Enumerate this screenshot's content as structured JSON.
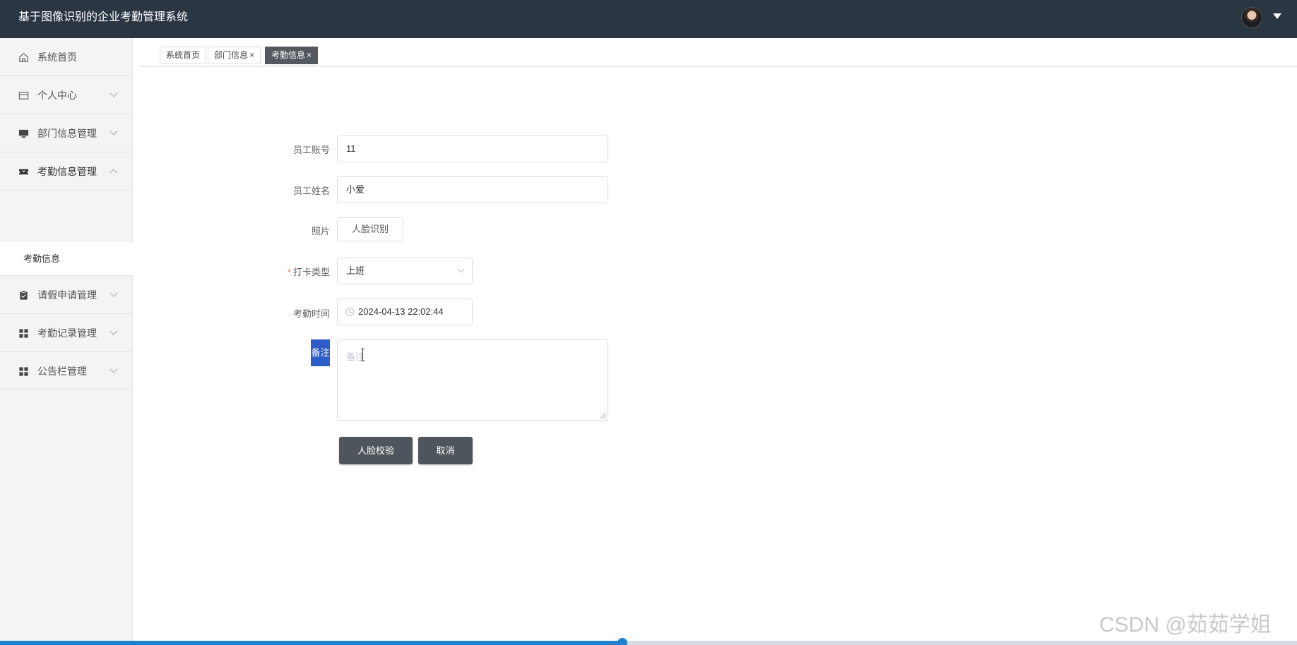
{
  "app": {
    "title": "基于图像识别的企业考勤管理系统"
  },
  "sidebar": {
    "items": [
      {
        "label": "系统首页",
        "icon": "home-icon"
      },
      {
        "label": "个人中心",
        "icon": "card-icon"
      },
      {
        "label": "部门信息管理",
        "icon": "monitor-icon"
      },
      {
        "label": "考勤信息管理",
        "icon": "ticket-icon"
      },
      {
        "label": "请假申请管理",
        "icon": "clipboard-icon"
      },
      {
        "label": "考勤记录管理",
        "icon": "grid-icon"
      },
      {
        "label": "公告栏管理",
        "icon": "grid-icon"
      }
    ],
    "submenu": {
      "label": "考勤信息"
    }
  },
  "tabs": [
    {
      "label": "系统首页"
    },
    {
      "label": "部门信息",
      "close": "×"
    },
    {
      "label": "考勤信息",
      "close": "×"
    }
  ],
  "form": {
    "account": {
      "label": "员工账号",
      "value": "11"
    },
    "name": {
      "label": "员工姓名",
      "value": "小爱"
    },
    "photo": {
      "label": "照片",
      "button": "人脸识别"
    },
    "punch_type": {
      "label": "打卡类型",
      "required_mark": "*",
      "value": "上班"
    },
    "time": {
      "label": "考勤时间",
      "value": "2024-04-13 22:02:44"
    },
    "remark": {
      "label": "备注",
      "placeholder": "备注"
    },
    "buttons": {
      "verify": "人脸校验",
      "cancel": "取消"
    }
  },
  "watermark": "CSDN @茹茹学姐",
  "colors": {
    "header": "#2b3643",
    "active_tab": "#54595f",
    "primary_button": "#4f555c",
    "highlight": "#2f5dc8",
    "progress": "#1f7fd0"
  },
  "progress": 0.48
}
